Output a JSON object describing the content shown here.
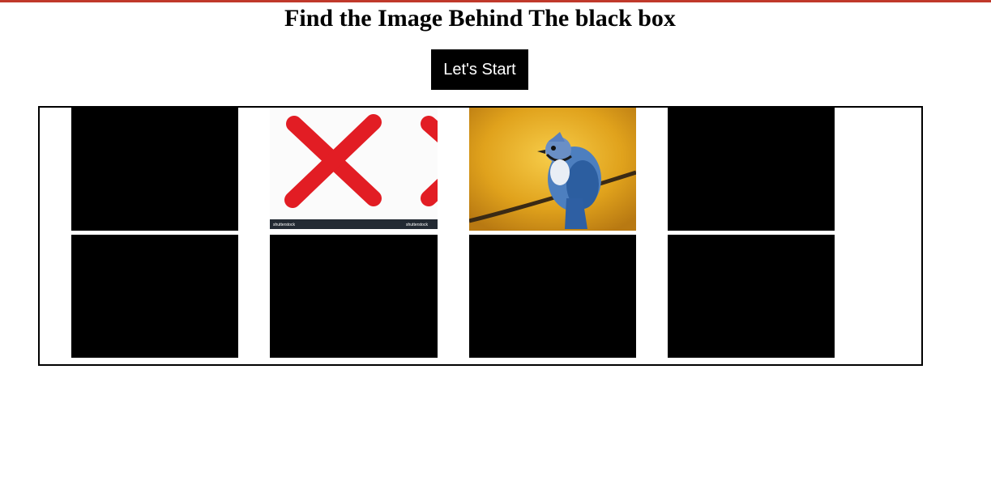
{
  "header": {
    "accent_color": "#c0392b",
    "title": "Find the Image Behind The black box",
    "start_label": "Let's Start"
  },
  "board": {
    "cards": [
      {
        "state": "hidden"
      },
      {
        "state": "revealed",
        "image": "red-x-icon",
        "watermark_left": "shutterstock",
        "watermark_right": "shutterstock"
      },
      {
        "state": "revealed",
        "image": "blue-jay-bird"
      },
      {
        "state": "hidden"
      },
      {
        "state": "hidden"
      },
      {
        "state": "hidden"
      },
      {
        "state": "hidden"
      },
      {
        "state": "hidden"
      }
    ]
  }
}
